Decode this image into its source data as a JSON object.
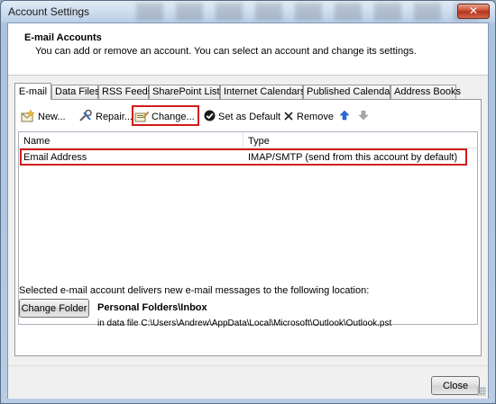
{
  "window": {
    "title": "Account Settings",
    "close_glyph": "✕"
  },
  "header": {
    "title": "E-mail Accounts",
    "description": "You can add or remove an account. You can select an account and change its settings."
  },
  "tabs": [
    {
      "label": "E-mail",
      "active": true
    },
    {
      "label": "Data Files"
    },
    {
      "label": "RSS Feeds"
    },
    {
      "label": "SharePoint Lists"
    },
    {
      "label": "Internet Calendars"
    },
    {
      "label": "Published Calendars"
    },
    {
      "label": "Address Books"
    }
  ],
  "toolbar": {
    "new_label": "New...",
    "repair_label": "Repair...",
    "change_label": "Change...",
    "set_default_label": "Set as Default",
    "remove_label": "Remove"
  },
  "accounts_table": {
    "columns": {
      "name": "Name",
      "type": "Type"
    },
    "rows": [
      {
        "name": "Email Address",
        "type": "IMAP/SMTP (send from this account by default)"
      }
    ]
  },
  "delivery": {
    "text": "Selected e-mail account delivers new e-mail messages to the following location:",
    "change_folder_label": "Change Folder",
    "folder": "Personal Folders\\Inbox",
    "path": "in data file C:\\Users\\Andrew\\AppData\\Local\\Microsoft\\Outlook\\Outlook.pst"
  },
  "footer": {
    "close_label": "Close"
  },
  "colors": {
    "highlight": "#d21b1b",
    "accent_blue": "#2a6ad8"
  },
  "icons": [
    "new-mail-icon",
    "repair-icon",
    "change-icon",
    "checkmark-icon",
    "remove-x-icon",
    "arrow-up-icon",
    "arrow-down-icon"
  ]
}
